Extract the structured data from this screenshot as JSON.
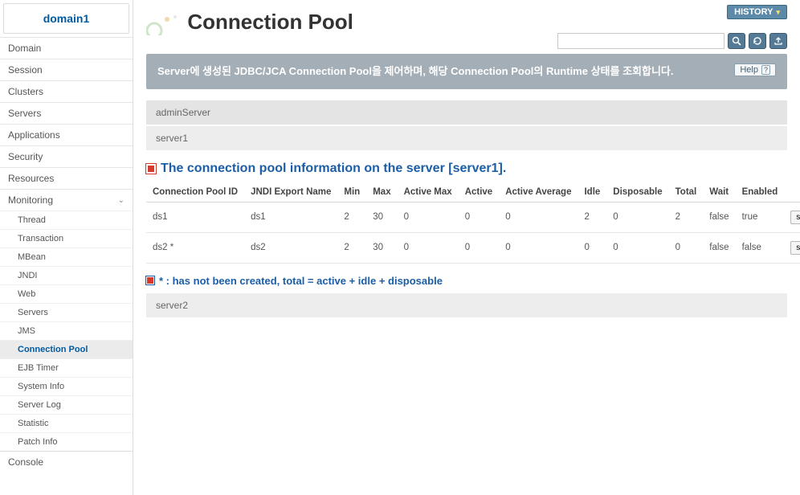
{
  "sidebar": {
    "domain": "domain1",
    "nav": [
      {
        "label": "Domain"
      },
      {
        "label": "Session"
      },
      {
        "label": "Clusters"
      },
      {
        "label": "Servers"
      },
      {
        "label": "Applications"
      },
      {
        "label": "Security"
      },
      {
        "label": "Resources"
      }
    ],
    "monitoring_label": "Monitoring",
    "monitoring_items": [
      "Thread",
      "Transaction",
      "MBean",
      "JNDI",
      "Web",
      "Servers",
      "JMS",
      "Connection Pool",
      "EJB Timer",
      "System Info",
      "Server Log",
      "Statistic",
      "Patch Info"
    ],
    "monitoring_active": "Connection Pool",
    "console_label": "Console"
  },
  "header": {
    "history_label": "HISTORY",
    "page_title": "Connection Pool",
    "search_placeholder": ""
  },
  "description": {
    "text": "Server에 생성된 JDBC/JCA Connection Pool을 제어하며, 해당 Connection Pool의 Runtime 상태를 조회합니다.",
    "help_label": "Help"
  },
  "servers": {
    "admin": "adminServer",
    "server1": "server1",
    "server2": "server2"
  },
  "section": {
    "heading": "The connection pool information on the server [server1].",
    "columns": [
      "Connection Pool ID",
      "JNDI Export Name",
      "Min",
      "Max",
      "Active Max",
      "Active",
      "Active Average",
      "Idle",
      "Disposable",
      "Total",
      "Wait",
      "Enabled",
      ""
    ],
    "rows": [
      {
        "id": "ds1",
        "jndi": "ds1",
        "min": "2",
        "max": "30",
        "activeMax": "0",
        "active": "0",
        "activeAvg": "0",
        "idle": "2",
        "disposable": "0",
        "total": "2",
        "wait": "false",
        "enabled": "true",
        "btn": "stmt"
      },
      {
        "id": "ds2 *",
        "jndi": "ds2",
        "min": "2",
        "max": "30",
        "activeMax": "0",
        "active": "0",
        "activeAvg": "0",
        "idle": "0",
        "disposable": "0",
        "total": "0",
        "wait": "false",
        "enabled": "false",
        "btn": "stmt"
      }
    ],
    "note": "* : has not been created, total = active + idle + disposable"
  }
}
